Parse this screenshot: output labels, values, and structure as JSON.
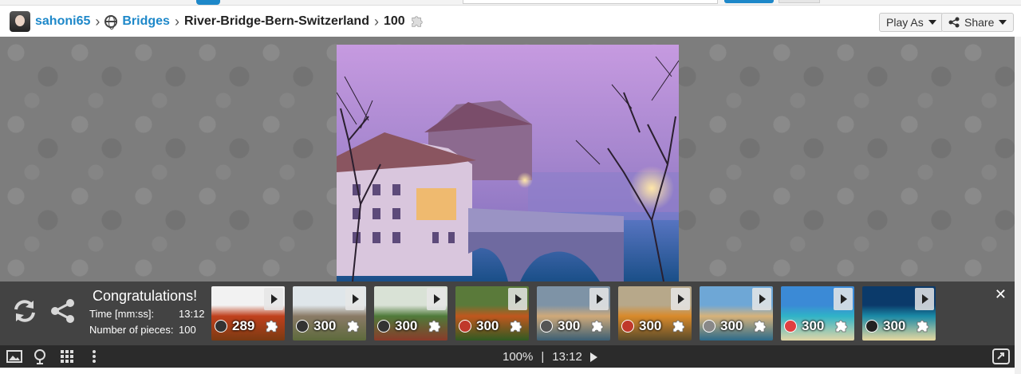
{
  "breadcrumb": {
    "user": "sahoni65",
    "category": "Bridges",
    "puzzle_name": "River-Bridge-Bern-Switzerland",
    "pieces": "100"
  },
  "header_buttons": {
    "play_as": "Play As",
    "share": "Share"
  },
  "congrats": {
    "title": "Congratulations!",
    "time_label": "Time [mm:ss]:",
    "time_value": "13:12",
    "pieces_label": "Number of pieces:",
    "pieces_value": "100"
  },
  "thumbnails": [
    {
      "pieces": "289",
      "sky": "#f2f2f2",
      "mid": "#c0401c",
      "ground": "#7a3a12",
      "avatar_color": "#333"
    },
    {
      "pieces": "300",
      "sky": "#dfe6ea",
      "mid": "#8a7a66",
      "ground": "#5d6a3c",
      "avatar_color": "#333"
    },
    {
      "pieces": "300",
      "sky": "#d9e2d6",
      "mid": "#4f7a3a",
      "ground": "#8a3a2a",
      "avatar_color": "#333"
    },
    {
      "pieces": "300",
      "sky": "#5a7a3a",
      "mid": "#c0571e",
      "ground": "#2f5a22",
      "avatar_color": "#c0392b"
    },
    {
      "pieces": "300",
      "sky": "#7e93a6",
      "mid": "#cfa979",
      "ground": "#3b5e74",
      "avatar_color": "#555"
    },
    {
      "pieces": "300",
      "sky": "#b7a88a",
      "mid": "#d98a2b",
      "ground": "#5a4a2a",
      "avatar_color": "#c0392b"
    },
    {
      "pieces": "300",
      "sky": "#6ea7d6",
      "mid": "#d7b27a",
      "ground": "#2b6a8a",
      "avatar_color": "#888"
    },
    {
      "pieces": "300",
      "sky": "#3b8ad6",
      "mid": "#2fb3c7",
      "ground": "#e2d6a6",
      "avatar_color": "#e04040"
    },
    {
      "pieces": "300",
      "sky": "#0b3a6a",
      "mid": "#1a8aa6",
      "ground": "#e8d9a0",
      "avatar_color": "#222"
    }
  ],
  "status": {
    "zoom": "100%",
    "divider": "|",
    "timer": "13:12"
  },
  "colors": {
    "accent": "#1e88c9",
    "board": "#7d7d7d",
    "panel": "#434343",
    "statusbar": "#2b2b2b"
  }
}
